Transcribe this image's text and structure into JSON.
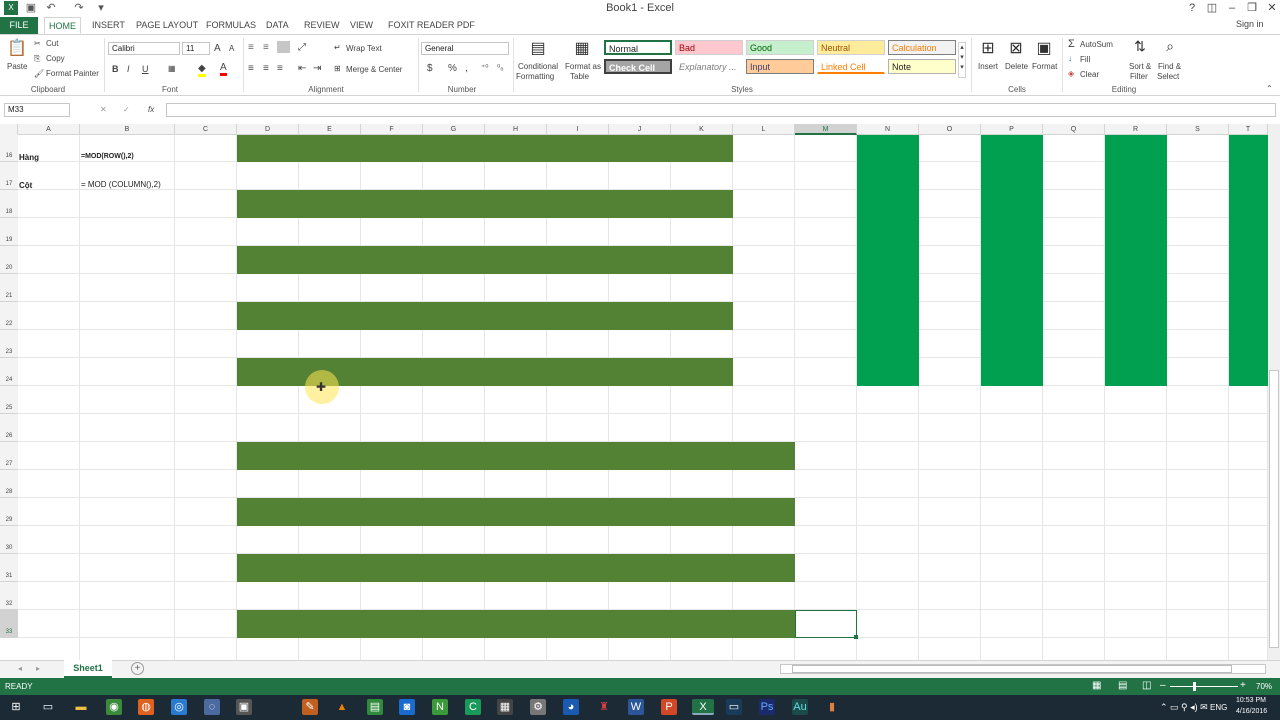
{
  "window": {
    "title": "Book1 - Excel",
    "signin": "Sign in",
    "help": "?"
  },
  "tabs": [
    "FILE",
    "HOME",
    "INSERT",
    "PAGE LAYOUT",
    "FORMULAS",
    "DATA",
    "REVIEW",
    "VIEW",
    "FOXIT READER PDF"
  ],
  "ribbon": {
    "clipboard": {
      "paste": "Paste",
      "cut": "Cut",
      "copy": "Copy",
      "format_painter": "Format Painter",
      "group": "Clipboard"
    },
    "font": {
      "name": "Calibri",
      "size": "11",
      "bold": "B",
      "italic": "I",
      "underline": "U",
      "grow": "A",
      "shrink": "A",
      "group": "Font"
    },
    "alignment": {
      "wrap": "Wrap Text",
      "merge": "Merge & Center",
      "group": "Alignment"
    },
    "number": {
      "format": "General",
      "currency": "$",
      "percent": "%",
      "comma": ",",
      "group": "Number"
    },
    "styles": {
      "conditional": "Conditional",
      "conditional2": "Formatting",
      "format_table": "Format as",
      "format_table2": "Table",
      "normal": "Normal",
      "bad": "Bad",
      "good": "Good",
      "neutral": "Neutral",
      "calculation": "Calculation",
      "check_cell": "Check Cell",
      "explanatory": "Explanatory ...",
      "input": "Input",
      "linked_cell": "Linked Cell",
      "note": "Note",
      "group": "Styles"
    },
    "cells": {
      "insert": "Insert",
      "delete": "Delete",
      "format": "Format",
      "group": "Cells"
    },
    "editing": {
      "autosum": "AutoSum",
      "fill": "Fill",
      "clear": "Clear",
      "sort": "Sort &",
      "sort2": "Filter",
      "find": "Find &",
      "find2": "Select",
      "group": "Editing"
    }
  },
  "formula_bar": {
    "name_box": "M33",
    "fx": "fx",
    "cancel": "✕",
    "enter": "✓"
  },
  "columns": [
    "A",
    "B",
    "C",
    "D",
    "E",
    "F",
    "G",
    "H",
    "I",
    "J",
    "K",
    "L",
    "M",
    "N",
    "O",
    "P",
    "Q",
    "R",
    "S",
    "T"
  ],
  "rows": [
    "16",
    "17",
    "18",
    "19",
    "20",
    "21",
    "22",
    "23",
    "24",
    "25",
    "26",
    "27",
    "28",
    "29",
    "30",
    "31",
    "32",
    "33"
  ],
  "cells": {
    "a16": "Hàng",
    "b16": "=MOD(ROW(),2)",
    "a17": "Cột",
    "b17": "= MOD (COLUMN(),2)"
  },
  "sheet": {
    "tab": "Sheet1",
    "add": "+"
  },
  "status": {
    "ready": "READY",
    "zoom": "70%"
  },
  "taskbar": {
    "lang": "ENG",
    "time": "10:53 PM",
    "date": "4/16/2016"
  },
  "colors": {
    "excel_green": "#217346",
    "band_green": "#548235",
    "column_green": "#00a050"
  }
}
